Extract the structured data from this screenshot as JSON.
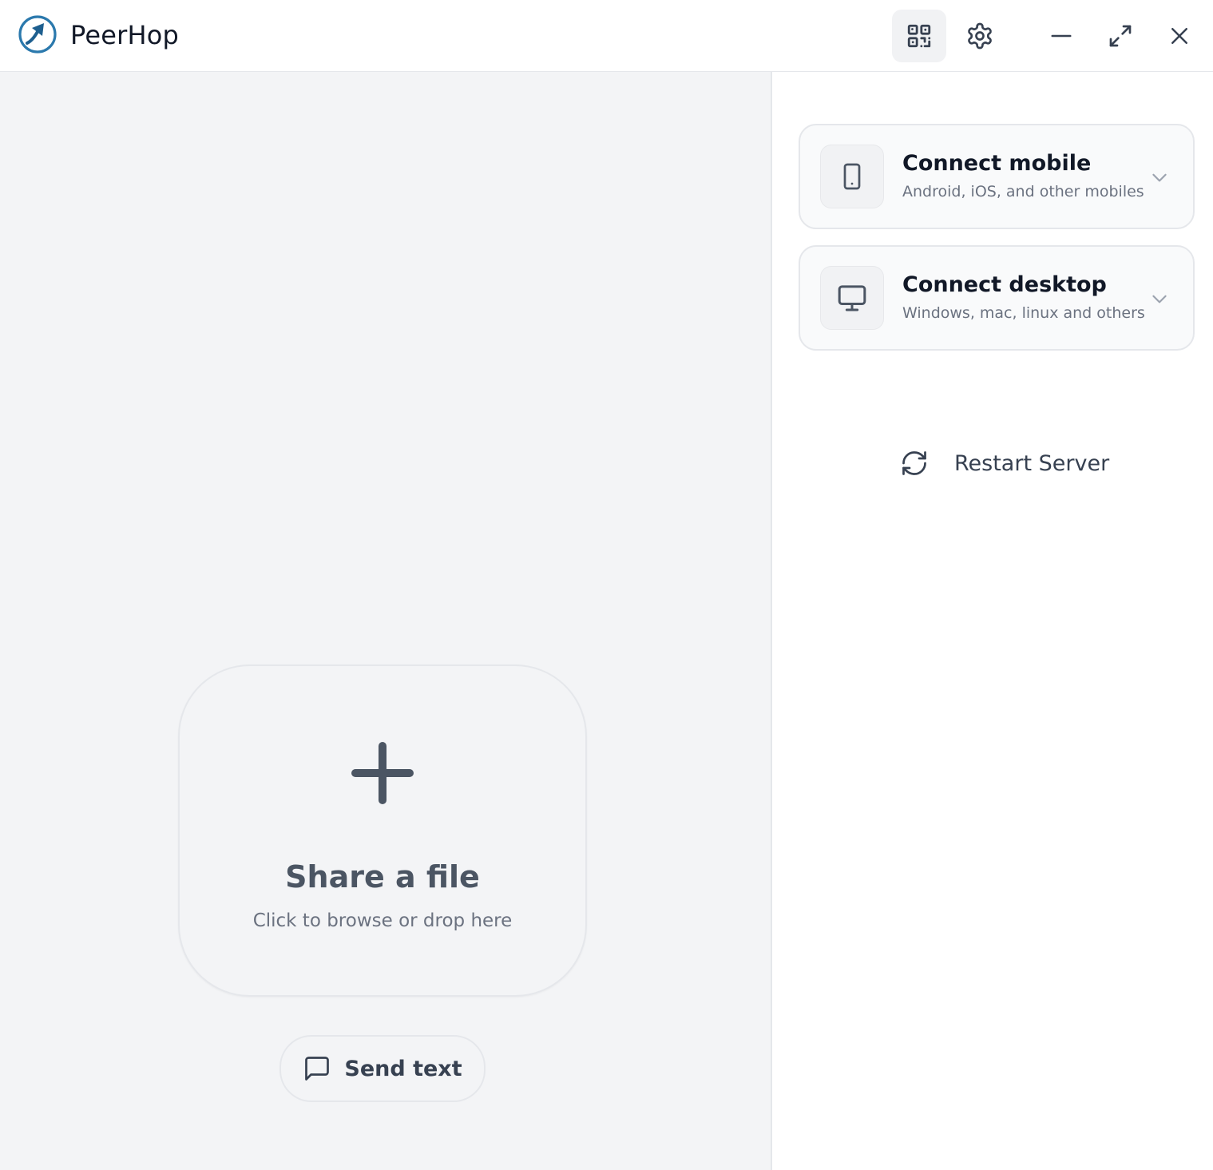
{
  "app": {
    "title": "PeerHop"
  },
  "titlebar": {
    "icons": [
      "qr-code-icon",
      "gear-icon",
      "minimize-icon",
      "expand-icon",
      "close-icon"
    ]
  },
  "share": {
    "title": "Share a file",
    "subtitle": "Click to browse or drop here",
    "icon": "plus-icon"
  },
  "send_text": {
    "label": "Send text",
    "icon": "message-square-icon"
  },
  "connections": [
    {
      "title": "Connect mobile",
      "subtitle": "Android, iOS, and other mobiles",
      "icon": "smartphone-icon"
    },
    {
      "title": "Connect desktop",
      "subtitle": "Windows, mac, linux and others",
      "icon": "monitor-icon"
    }
  ],
  "restart": {
    "label": "Restart Server",
    "icon": "refresh-icon"
  },
  "colors": {
    "brand": "#2b79ad",
    "left_background": "#f3f4f6",
    "icon": "#374151",
    "muted_text": "#6b7280"
  }
}
